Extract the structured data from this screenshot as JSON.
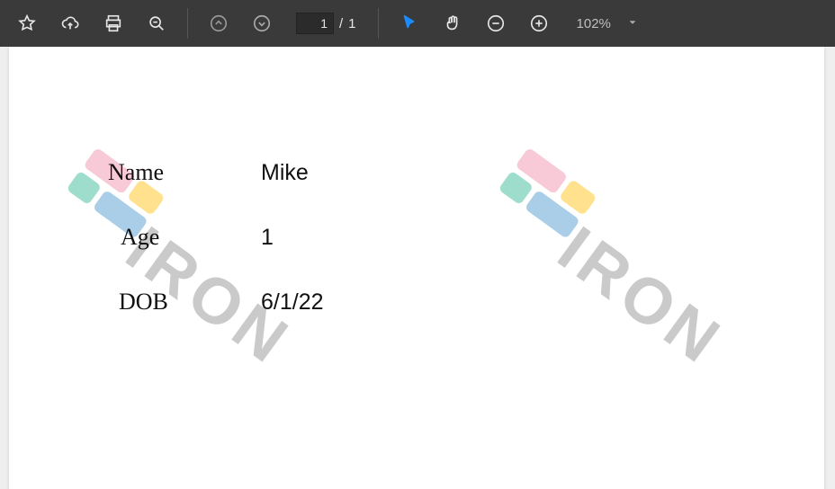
{
  "toolbar": {
    "current_page": "1",
    "total_pages": "1",
    "page_sep": "/",
    "zoom_level": "102%"
  },
  "document": {
    "watermark_text": "IRON",
    "fields": {
      "name_label": "Name",
      "name_value": "Mike",
      "age_label": "Age",
      "age_value": "1",
      "dob_label": "DOB",
      "dob_value": "6/1/22"
    }
  }
}
